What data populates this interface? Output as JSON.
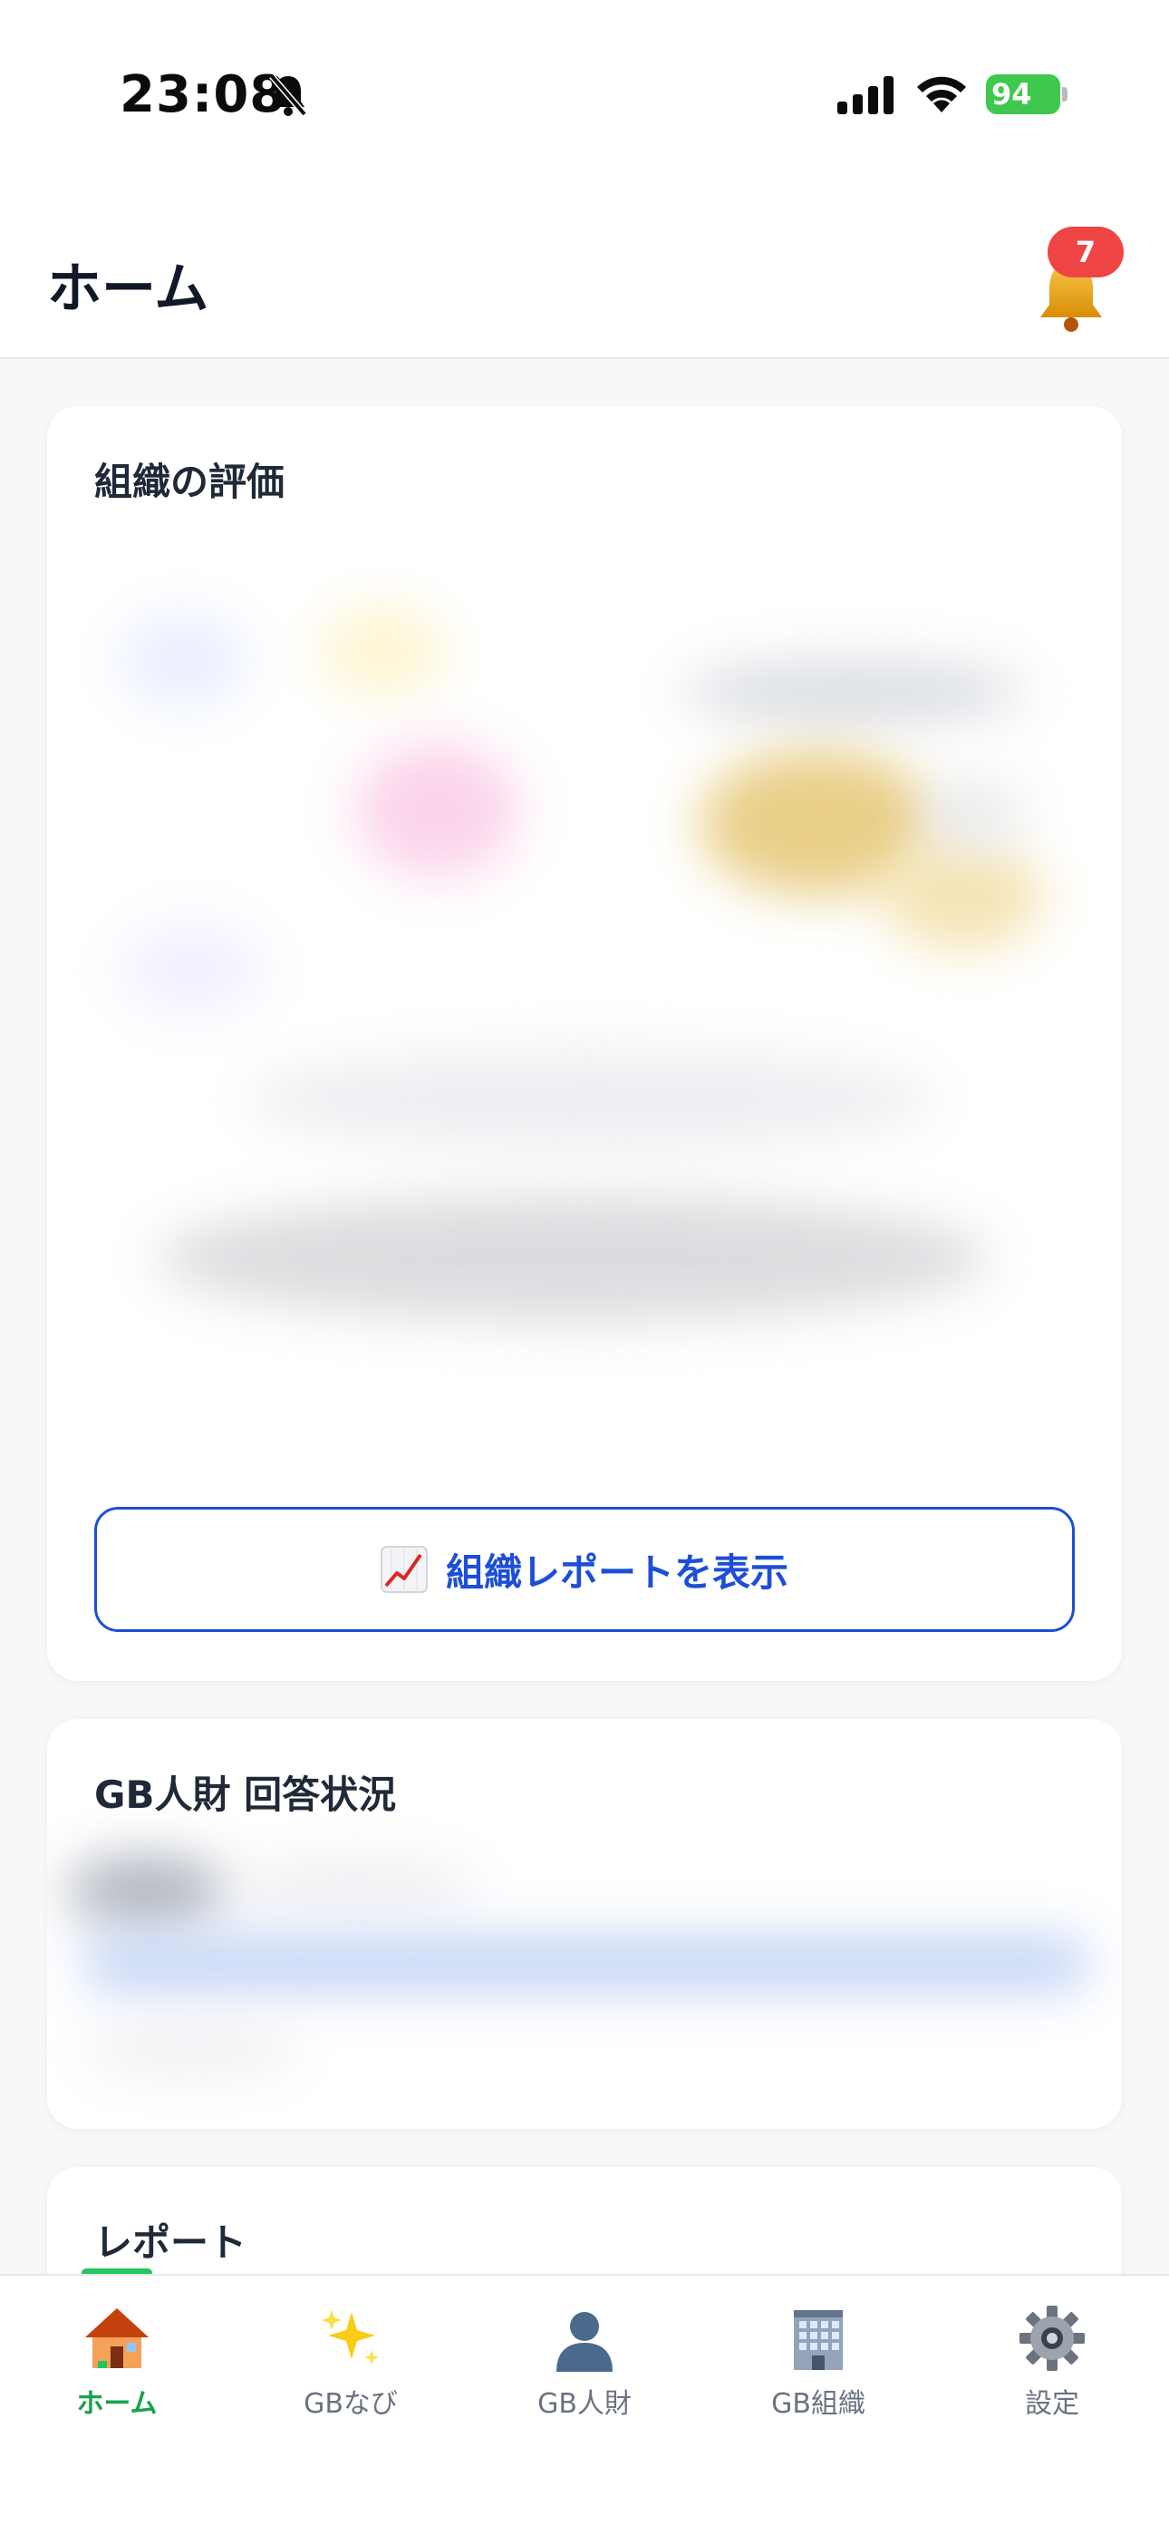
{
  "status_bar": {
    "time": "23:08",
    "battery": "94",
    "icons": [
      "bell-slash-icon",
      "signal-icon",
      "wifi-icon",
      "battery-icon"
    ]
  },
  "header": {
    "title": "ホーム",
    "notification_count": "7",
    "icon": "bell-icon"
  },
  "cards": {
    "evaluation": {
      "title": "組織の評価",
      "button_label": "組織レポートを表示",
      "button_icon": "chart-increasing-icon"
    },
    "response_status": {
      "title": "GB人財 回答状況"
    },
    "reports": {
      "title": "レポート"
    }
  },
  "tabs": [
    {
      "label": "ホーム",
      "icon": "house-icon",
      "active": true
    },
    {
      "label": "GBなび",
      "icon": "sparkles-icon",
      "active": false
    },
    {
      "label": "GB人財",
      "icon": "person-silhouette-icon",
      "active": false
    },
    {
      "label": "GB組織",
      "icon": "office-building-icon",
      "active": false
    },
    {
      "label": "設定",
      "icon": "gear-icon",
      "active": false
    }
  ],
  "colors": {
    "accent_blue": "#1d4ed8",
    "active_green": "#16a34a",
    "badge_red": "#ef4444",
    "battery_green": "#3fc84e"
  }
}
